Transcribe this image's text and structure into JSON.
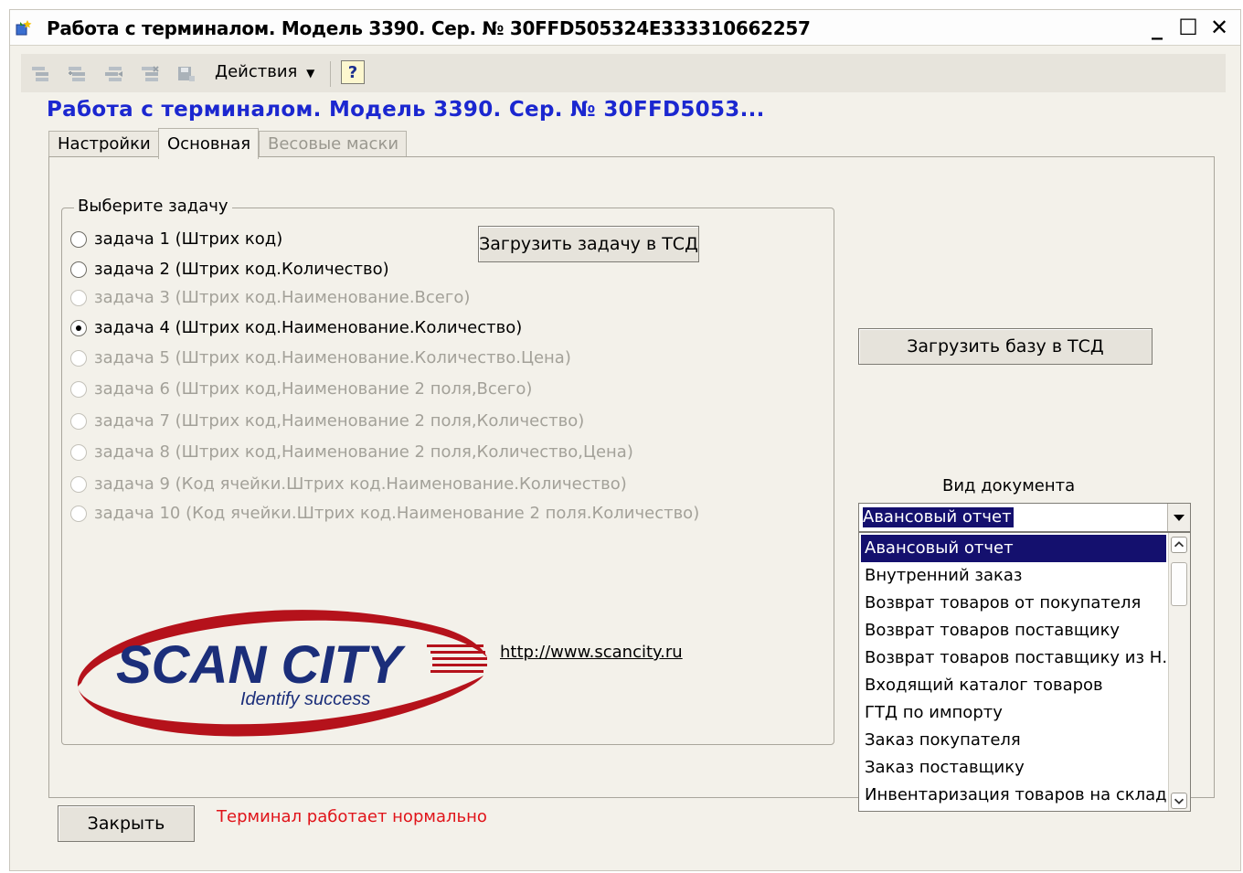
{
  "window": {
    "title": "Работа с терминалом. Модель 3390. Сер. № 30FFD505324E333310662257",
    "minimize_glyph": "_",
    "maximize_glyph": "☐",
    "close_glyph": "✕"
  },
  "toolbar": {
    "icons": [
      "tree-icon",
      "tree-add-icon",
      "tree-move-icon",
      "tree-remove-icon",
      "save-icon"
    ],
    "actions_label": "Действия",
    "help_label": "?"
  },
  "form": {
    "title": "Работа с терминалом. Модель 3390. Сер. № 30FFD5053..."
  },
  "tabs": [
    {
      "label": "Настройки",
      "state": "normal"
    },
    {
      "label": "Основная",
      "state": "active"
    },
    {
      "label": "Весовые маски",
      "state": "disabled"
    }
  ],
  "task_group": {
    "label": "Выберите задачу",
    "load_task_button": "Загрузить задачу в ТСД",
    "options": [
      {
        "label": "задача 1 (Штрих код)",
        "enabled": true,
        "checked": false
      },
      {
        "label": "задача 2 (Штрих код.Количество)",
        "enabled": true,
        "checked": false
      },
      {
        "label": "задача 3 (Штрих код.Наименование.Всего)",
        "enabled": false,
        "checked": false
      },
      {
        "label": "задача 4 (Штрих код.Наименование.Количество)",
        "enabled": true,
        "checked": true
      },
      {
        "label": "задача 5 (Штрих код.Наименование.Количество.Цена)",
        "enabled": false,
        "checked": false
      },
      {
        "label": "задача 6 (Штрих код,Наименование 2 поля,Всего)",
        "enabled": false,
        "checked": false
      },
      {
        "label": "задача 7 (Штрих код,Наименование 2 поля,Количество)",
        "enabled": false,
        "checked": false
      },
      {
        "label": "задача 8 (Штрих код,Наименование 2 поля,Количество,Цена)",
        "enabled": false,
        "checked": false
      },
      {
        "label": "задача 9 (Код ячейки.Штрих код.Наименование.Количество)",
        "enabled": false,
        "checked": false
      },
      {
        "label": "задача 10 (Код ячейки.Штрих код.Наименование 2 поля.Количество)",
        "enabled": false,
        "checked": false
      }
    ]
  },
  "logo": {
    "name": "SCAN CITY",
    "tagline": "Identify success"
  },
  "link": "http://www.scancity.ru",
  "load_base_button": "Загрузить базу в ТСД",
  "document_type": {
    "label": "Вид документа",
    "selected": "Авансовый отчет",
    "options": [
      "Авансовый отчет",
      "Внутренний заказ",
      "Возврат товаров от покупателя",
      "Возврат товаров поставщику",
      "Возврат товаров поставщику из Н...",
      "Входящий каталог товаров",
      "ГТД по импорту",
      "Заказ покупателя",
      "Заказ поставщику",
      "Инвентаризация товаров на складе"
    ]
  },
  "close_button": "Закрыть",
  "status_text": "Терминал работает нормально",
  "colors": {
    "form_title": "#1b27d0",
    "status": "#e0141a",
    "selection": "#14106e",
    "logo_blue": "#1b2e7a",
    "logo_red": "#b5121b"
  }
}
